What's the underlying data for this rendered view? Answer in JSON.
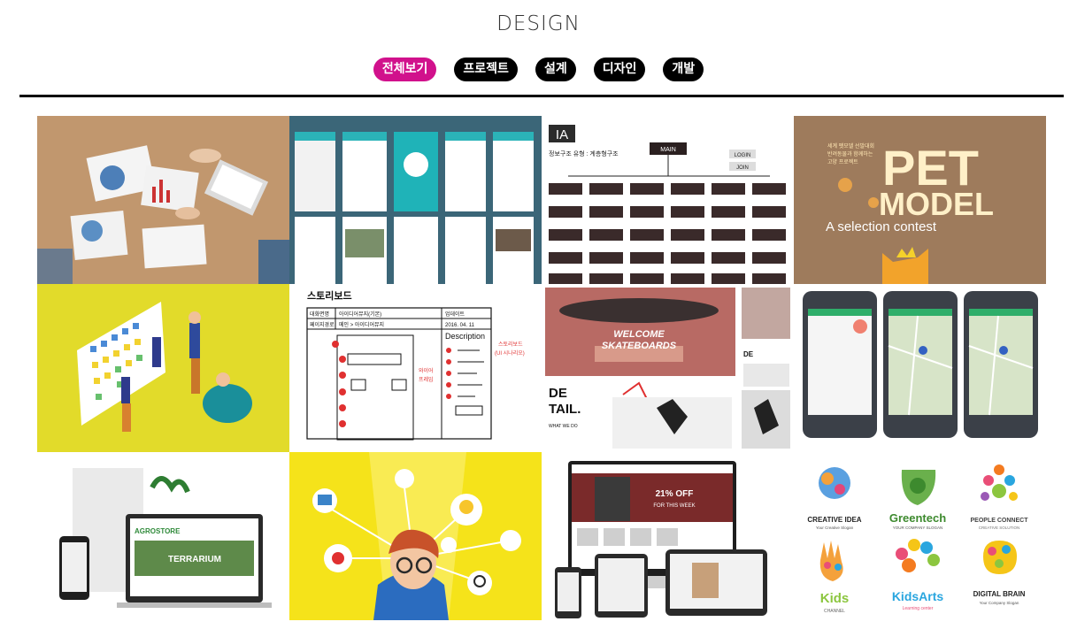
{
  "header": {
    "title": "DESIGN"
  },
  "filters": [
    {
      "label": "전체보기",
      "active": true
    },
    {
      "label": "프로젝트",
      "active": false
    },
    {
      "label": "설계",
      "active": false
    },
    {
      "label": "디자인",
      "active": false
    },
    {
      "label": "개발",
      "active": false
    }
  ],
  "colors": {
    "accent": "#d1118c",
    "chip": "#000000",
    "rule": "#000000"
  },
  "portfolio": {
    "ia": {
      "badge": "IA",
      "subtitle": "정보구조 유형 : 계층형구조",
      "main": "MAIN",
      "login": "LOGIN",
      "join": "JOIN"
    },
    "pet": {
      "tagline_1": "세계 펫모델 선발대회",
      "tagline_2": "반려동물과 함께하는",
      "tagline_3": "고양 프로젝트",
      "pet": "PET",
      "model": "MODEL",
      "sub": "A selection contest"
    },
    "storyboard": {
      "title": "스토리보드",
      "row1_label": "대화면명",
      "row1_value": "아이디어뮤지(기본)",
      "row1_right": "업데이트",
      "row2_label": "페이지경로",
      "row2_value": "메인 > 아이디어뮤지",
      "row2_right": "2016. 04. 11",
      "description": "Description",
      "note_1": "스토리보드",
      "note_2": "(UI 시나리오)",
      "note_3": "와이어",
      "note_4": "프레임"
    },
    "skate": {
      "welcome": "WELCOME",
      "skateboards": "SKATEBOARDS",
      "de": "DE",
      "tail": "TAIL.",
      "what": "WHAT WE DO"
    },
    "agro": {
      "brand": "AGROSTORE",
      "headline": "TERRARIUM"
    },
    "fashion": {
      "headline": "21% OFF",
      "sub": "FOR THIS WEEK"
    },
    "logos": [
      {
        "name": "CREATIVE IDEA",
        "slogan": "Your Creative Slogan"
      },
      {
        "name": "Greentech",
        "slogan": "YOUR COMPANY SLOGAN"
      },
      {
        "name": "PEOPLE CONNECT",
        "slogan": "CREATIVE SOLUTION"
      },
      {
        "name": "Kids",
        "slogan": "CHANNEL"
      },
      {
        "name": "KidsArts",
        "slogan": "Learning center"
      },
      {
        "name": "DIGITAL BRAIN",
        "slogan": "Your Company Slogan"
      }
    ]
  }
}
